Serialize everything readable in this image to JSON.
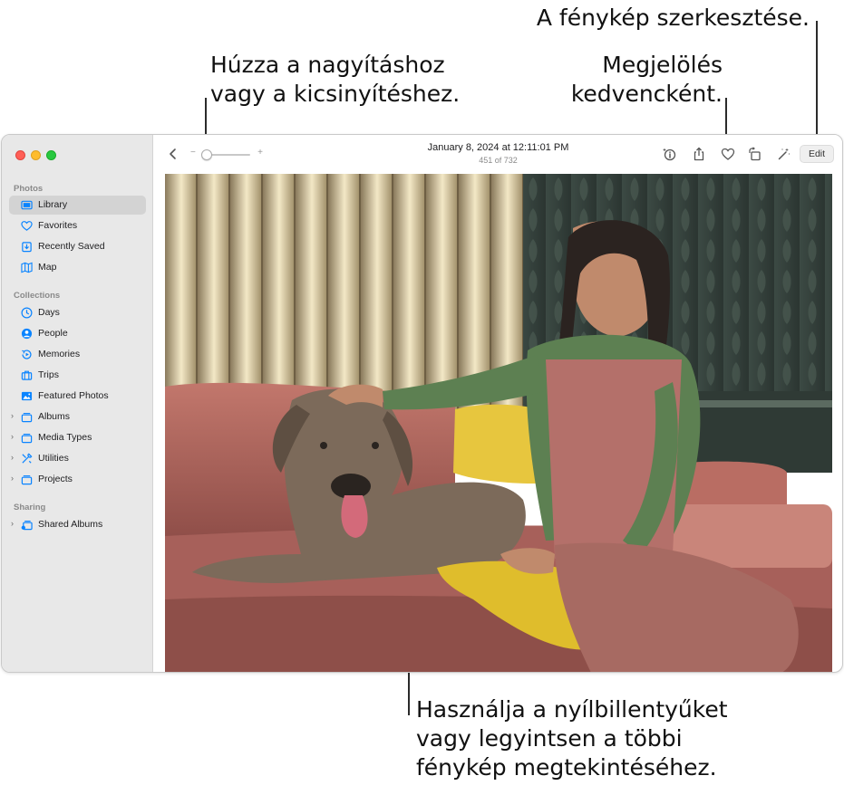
{
  "callouts": {
    "edit": "A fénykép szerkesztése.",
    "zoom_line1": "Húzza a nagyításhoz",
    "zoom_line2": "vagy a kicsinyítéshez.",
    "favorite_line1": "Megjelölés",
    "favorite_line2": "kedvencként.",
    "nav_line1": "Használja a nyílbillentyűket",
    "nav_line2": "vagy legyintsen a többi",
    "nav_line3": "fénykép megtekintéséhez."
  },
  "sidebar": {
    "sections": [
      {
        "title": "Photos",
        "items": [
          {
            "label": "Library",
            "icon": "library-icon",
            "selected": true
          },
          {
            "label": "Favorites",
            "icon": "heart-icon"
          },
          {
            "label": "Recently Saved",
            "icon": "recently-saved-icon"
          },
          {
            "label": "Map",
            "icon": "map-icon"
          }
        ]
      },
      {
        "title": "Collections",
        "items": [
          {
            "label": "Days",
            "icon": "days-icon"
          },
          {
            "label": "People",
            "icon": "people-icon"
          },
          {
            "label": "Memories",
            "icon": "memories-icon"
          },
          {
            "label": "Trips",
            "icon": "trips-icon"
          },
          {
            "label": "Featured Photos",
            "icon": "featured-photos-icon"
          },
          {
            "label": "Albums",
            "icon": "albums-icon",
            "expandable": true
          },
          {
            "label": "Media Types",
            "icon": "media-types-icon",
            "expandable": true
          },
          {
            "label": "Utilities",
            "icon": "utilities-icon",
            "expandable": true
          },
          {
            "label": "Projects",
            "icon": "projects-icon",
            "expandable": true
          }
        ]
      },
      {
        "title": "Sharing",
        "items": [
          {
            "label": "Shared Albums",
            "icon": "shared-albums-icon",
            "expandable": true
          }
        ]
      }
    ]
  },
  "toolbar": {
    "zoom_minus": "−",
    "zoom_plus": "+",
    "title": "January 8, 2024 at 12:11:01 PM",
    "subtitle": "451 of 732",
    "edit_label": "Edit",
    "zoom_level": 0
  },
  "colors": {
    "accent": "#0a84ff",
    "traffic_red": "#ff5f57",
    "traffic_yellow": "#febc2e",
    "traffic_green": "#28c840"
  }
}
